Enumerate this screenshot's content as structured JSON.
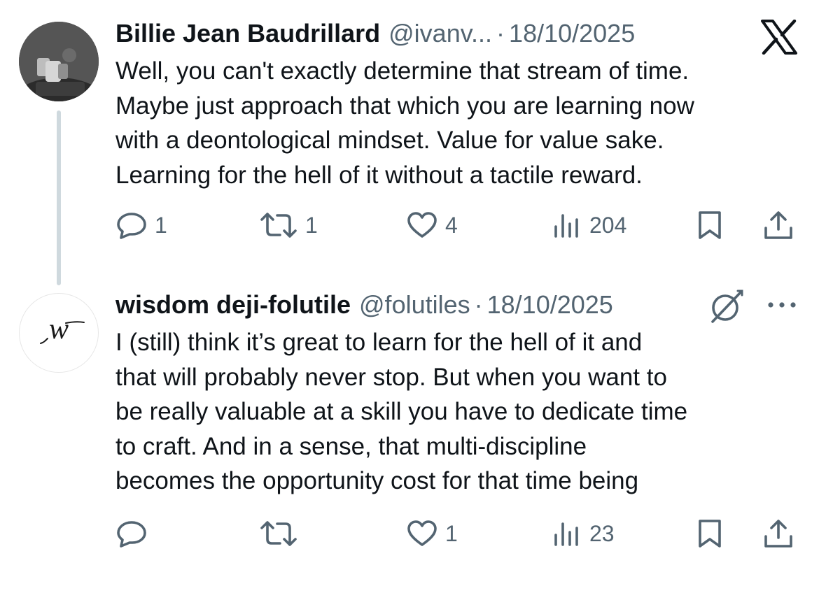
{
  "platform": {
    "logo": "x-logo-icon"
  },
  "tweets": [
    {
      "author_name": "Billie Jean Baudrillard",
      "handle": "@ivanv...",
      "separator": "·",
      "date": "18/10/2025",
      "text_lines": [
        "Well, you can't exactly determine that stream of time.",
        "Maybe just approach that which you are learning now",
        "with a deontological mindset. Value for value sake.",
        "Learning for the hell of it without a tactile reward."
      ],
      "replies": "1",
      "reposts": "1",
      "likes": "4",
      "views": "204"
    },
    {
      "author_name": "wisdom deji-folutile",
      "handle": "@folutiles",
      "separator": "·",
      "date": "18/10/2025",
      "avatar_monogram": "w",
      "text_lines": [
        "I (still) think it’s great to learn for the hell of it and",
        "that will probably never stop. But when you want to",
        "be really valuable at a skill you have to dedicate time",
        "to craft. And in a sense, that multi-discipline",
        "becomes the opportunity cost for that time being"
      ],
      "replies": "",
      "reposts": "",
      "likes": "1",
      "views": "23"
    }
  ],
  "colors": {
    "text": "#0f1419",
    "secondary": "#536471",
    "thread_line": "#cfd9de",
    "background": "#ffffff"
  }
}
